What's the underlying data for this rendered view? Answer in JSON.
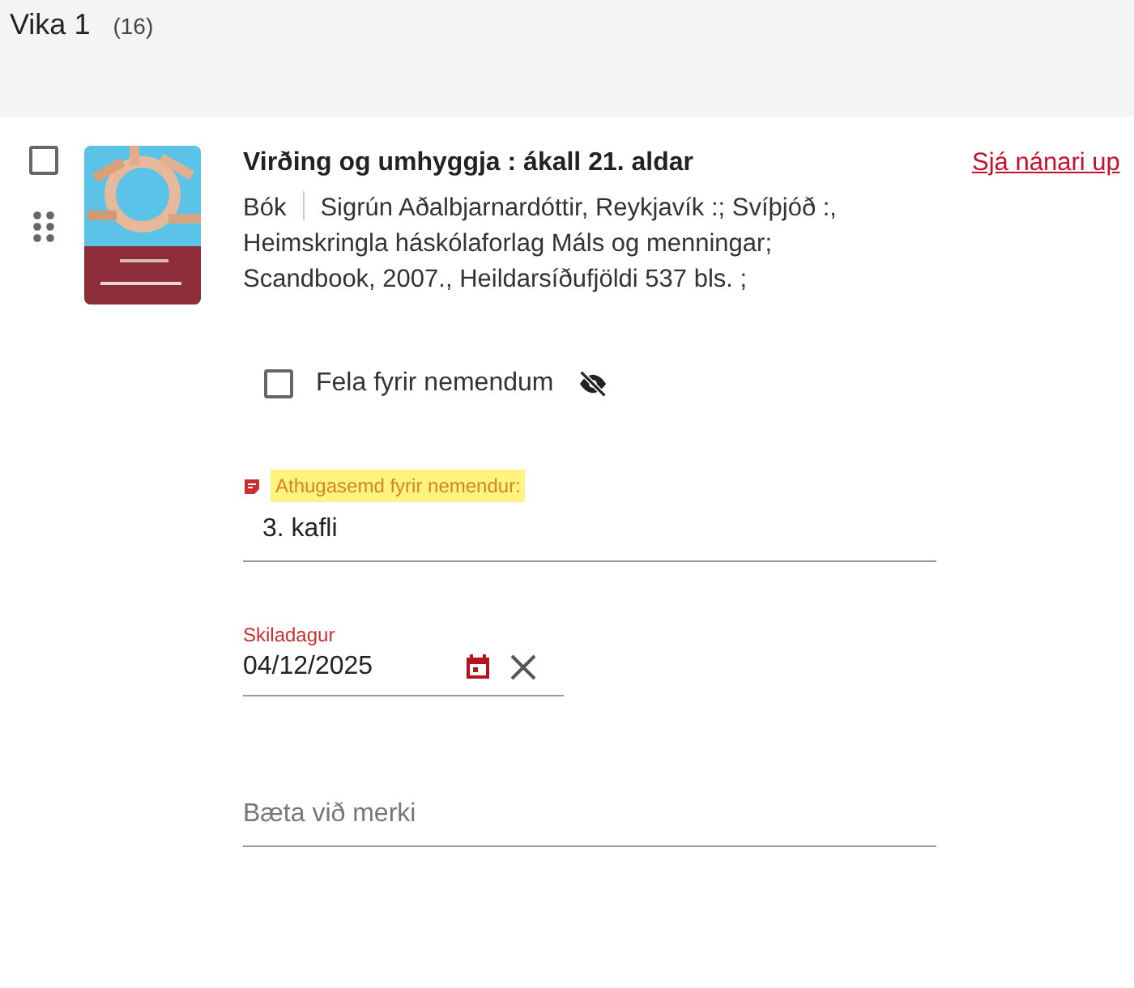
{
  "header": {
    "title": "Vika 1",
    "count": "(16)"
  },
  "item": {
    "checked": false,
    "title": "Virðing og umhyggja : ákall 21. aldar",
    "type": "Bók",
    "details": "Sigrún Aðalbjarnardóttir, Reykjavík :; Svíþjóð :, Heimskringla háskólaforlag Máls og menningar; Scandbook, 2007., Heildarsíðufjöldi 537 bls. ;",
    "more_link": "Sjá nánari up",
    "hide": {
      "label": "Fela fyrir nemendum",
      "checked": false
    },
    "note": {
      "label": "Athugasemd fyrir nemendur:",
      "value": "3. kafli"
    },
    "due_date": {
      "label": "Skiladagur",
      "value": "04/12/2025"
    },
    "tags": {
      "placeholder": "Bæta við merki"
    }
  }
}
